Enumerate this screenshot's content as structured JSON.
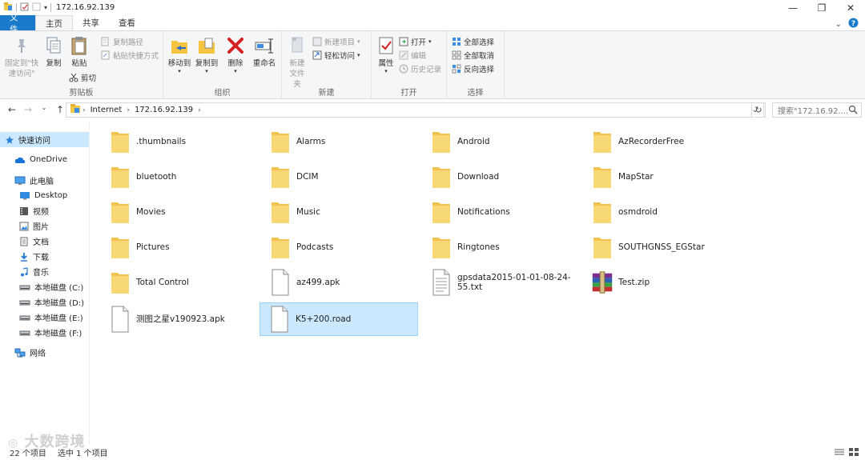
{
  "window": {
    "title": "172.16.92.139",
    "minimize": "—",
    "maximize": "❐",
    "close": "✕"
  },
  "tabs": [
    {
      "label": "文件"
    },
    {
      "label": "主页"
    },
    {
      "label": "共享"
    },
    {
      "label": "查看"
    }
  ],
  "ribbon": {
    "clipboard": {
      "label": "剪贴板",
      "pin": "固定到\"快速访问\"",
      "copy": "复制",
      "paste": "粘贴",
      "copy_path": "复制路径",
      "paste_shortcut": "粘贴快捷方式",
      "cut": "剪切"
    },
    "organize": {
      "label": "组织",
      "move_to": "移动到",
      "copy_to": "复制到",
      "delete": "删除",
      "rename": "重命名"
    },
    "new": {
      "label": "新建",
      "new_folder": "新建文件夹",
      "new_item": "新建项目",
      "easy_access": "轻松访问"
    },
    "open": {
      "label": "打开",
      "properties": "属性",
      "open": "打开",
      "edit": "编辑",
      "history": "历史记录"
    },
    "select": {
      "label": "选择",
      "select_all": "全部选择",
      "select_none": "全部取消",
      "invert": "反向选择"
    }
  },
  "address": {
    "crumbs": [
      "Internet",
      "172.16.92.139"
    ],
    "search_placeholder": "搜索\"172.16.92....",
    "dropdown": "⌄",
    "refresh": "↻"
  },
  "nav": {
    "items": [
      {
        "label": "快速访问",
        "icon": "star-icon"
      },
      {
        "label": "OneDrive",
        "icon": "cloud-icon"
      },
      {
        "label": "此电脑",
        "icon": "computer-icon"
      },
      {
        "label": "Desktop",
        "icon": "desktop-icon"
      },
      {
        "label": "视频",
        "icon": "video-icon"
      },
      {
        "label": "图片",
        "icon": "picture-icon"
      },
      {
        "label": "文档",
        "icon": "document-icon"
      },
      {
        "label": "下载",
        "icon": "download-icon"
      },
      {
        "label": "音乐",
        "icon": "music-icon"
      },
      {
        "label": "本地磁盘 (C:)",
        "icon": "drive-icon"
      },
      {
        "label": "本地磁盘 (D:)",
        "icon": "drive-icon"
      },
      {
        "label": "本地磁盘 (E:)",
        "icon": "drive-icon"
      },
      {
        "label": "本地磁盘 (F:)",
        "icon": "drive-icon"
      },
      {
        "label": "网络",
        "icon": "network-icon"
      }
    ]
  },
  "files": [
    {
      "name": ".thumbnails",
      "type": "folder"
    },
    {
      "name": "Alarms",
      "type": "folder"
    },
    {
      "name": "Android",
      "type": "folder"
    },
    {
      "name": "AzRecorderFree",
      "type": "folder"
    },
    {
      "name": "bluetooth",
      "type": "folder"
    },
    {
      "name": "DCIM",
      "type": "folder"
    },
    {
      "name": "Download",
      "type": "folder"
    },
    {
      "name": "MapStar",
      "type": "folder"
    },
    {
      "name": "Movies",
      "type": "folder"
    },
    {
      "name": "Music",
      "type": "folder"
    },
    {
      "name": "Notifications",
      "type": "folder"
    },
    {
      "name": "osmdroid",
      "type": "folder"
    },
    {
      "name": "Pictures",
      "type": "folder"
    },
    {
      "name": "Podcasts",
      "type": "folder"
    },
    {
      "name": "Ringtones",
      "type": "folder"
    },
    {
      "name": "SOUTHGNSS_EGStar",
      "type": "folder"
    },
    {
      "name": "Total Control",
      "type": "folder"
    },
    {
      "name": "az499.apk",
      "type": "file"
    },
    {
      "name": "gpsdata2015-01-01-08-24-55.txt",
      "type": "text"
    },
    {
      "name": "Test.zip",
      "type": "zip"
    },
    {
      "name": "测图之星v190923.apk",
      "type": "file"
    },
    {
      "name": "K5+200.road",
      "type": "file",
      "selected": true
    }
  ],
  "status": {
    "count": "22 个项目",
    "selected": "选中 1 个项目"
  },
  "watermark": "大数跨境",
  "colors": {
    "accent": "#1979ca",
    "selection": "#cce8ff",
    "folder": "#f8d775"
  }
}
